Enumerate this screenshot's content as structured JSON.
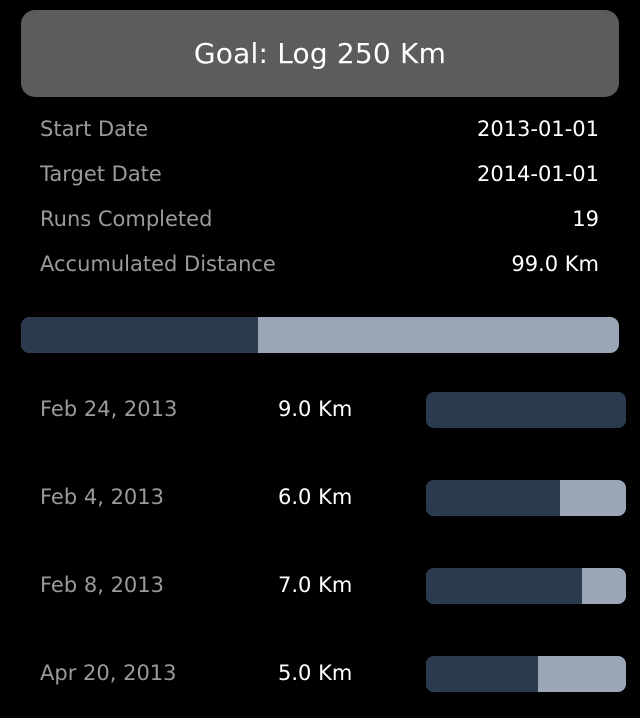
{
  "goal": {
    "title": "Goal: Log 250 Km",
    "progress_fraction": 0.396
  },
  "stats": [
    {
      "label": "Start Date",
      "value": "2013-01-01"
    },
    {
      "label": "Target Date",
      "value": "2014-01-01"
    },
    {
      "label": "Runs Completed",
      "value": "19"
    },
    {
      "label": "Accumulated Distance",
      "value": "99.0 Km"
    }
  ],
  "runs": [
    {
      "date": "Feb 24, 2013",
      "distance": "9.0 Km",
      "bar_fraction": 1.0
    },
    {
      "date": "Feb 4, 2013",
      "distance": "6.0 Km",
      "bar_fraction": 0.67
    },
    {
      "date": "Feb 8, 2013",
      "distance": "7.0 Km",
      "bar_fraction": 0.78
    },
    {
      "date": "Apr 20, 2013",
      "distance": "5.0 Km",
      "bar_fraction": 0.56
    }
  ],
  "colors": {
    "header_bg": "#5c5c5c",
    "bar_fill": "#2b3b4d",
    "bar_track": "#9aa6b5",
    "label_gray": "#9a9a9a",
    "value_white": "#ffffff"
  }
}
